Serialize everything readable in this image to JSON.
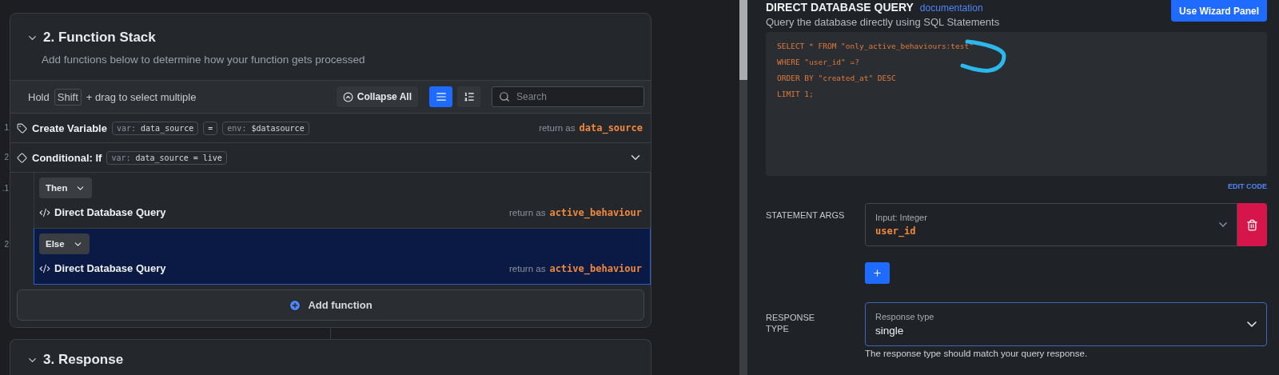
{
  "stack": {
    "title": "2. Function Stack",
    "subtitle": "Add functions below to determine how your function gets processed",
    "expanded": true,
    "toolbar": {
      "hint_before": "Hold",
      "key": "Shift",
      "hint_after": "+ drag to select multiple",
      "collapse_label": "Collapse All",
      "view_modes": [
        {
          "kind": "list",
          "selected": true
        },
        {
          "kind": "numbered",
          "selected": false
        }
      ],
      "search_placeholder": "Search"
    },
    "steps": [
      {
        "number": "1",
        "kind": "variable",
        "title": "Create Variable",
        "pills": [
          {
            "prefix": "var:",
            "value": "data_source"
          },
          {
            "value": "="
          },
          {
            "prefix": "env:",
            "value": "$datasource"
          }
        ],
        "return_label": "return as",
        "return_value": "data_source"
      },
      {
        "number": "2",
        "kind": "conditional",
        "title": "Conditional: If",
        "pills": [
          {
            "prefix": "var:",
            "value": "data_source = live"
          }
        ],
        "expanded": true,
        "children": [
          {
            "number": ".1",
            "kind": "branch",
            "branch": "Then",
            "title": "Direct Database Query",
            "return_label": "return as",
            "return_value": "active_behaviour",
            "selected": false
          },
          {
            "number": "2",
            "kind": "branch",
            "branch": "Else",
            "title": "Direct Database Query",
            "return_label": "return as",
            "return_value": "active_behaviour",
            "selected": true
          }
        ]
      }
    ],
    "add_label": "Add function"
  },
  "next_section": {
    "title": "3. Response",
    "expanded": true
  },
  "query_panel": {
    "title": "DIRECT DATABASE QUERY",
    "doc_link": "documentation",
    "subtitle": "Query the database directly using SQL Statements",
    "wizard_button": "Use Wizard Panel",
    "code_lines": [
      "SELECT * FROM \"only_active_behaviours:test\"",
      "WHERE \"user_id\" =?",
      "ORDER BY \"created_at\" DESC",
      "LIMIT 1;"
    ],
    "edit_code": "EDIT CODE",
    "args_label": "STATEMENT ARGS",
    "args": [
      {
        "type_label": "Input: Integer",
        "value": "user_id"
      }
    ],
    "response_label": "RESPONSE TYPE",
    "response_field_label": "Response type",
    "response_value": "single",
    "response_hint": "The response type should match your query response."
  }
}
